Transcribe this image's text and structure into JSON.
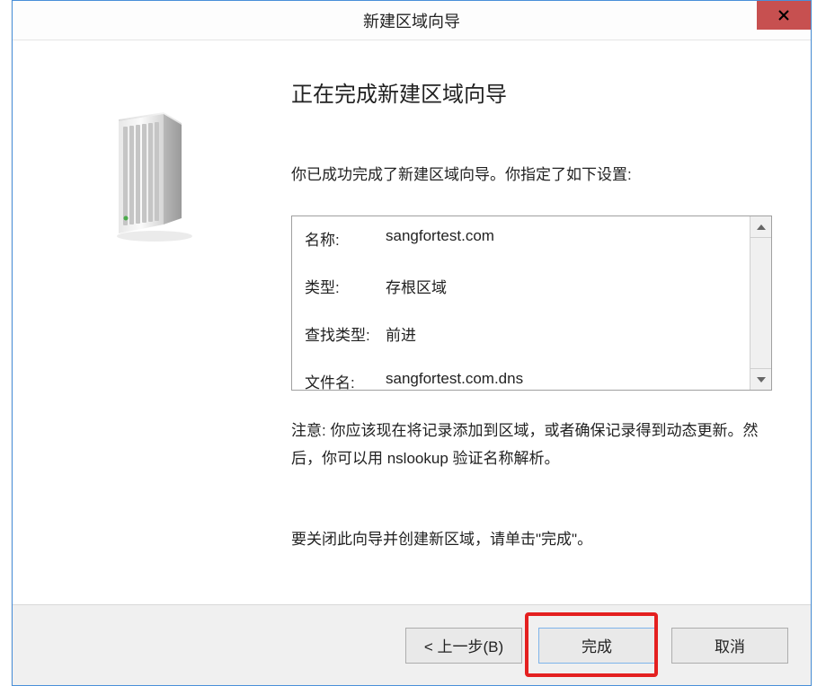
{
  "backdrop_text": "",
  "dialog": {
    "title": "新建区域向导",
    "close_label": "x",
    "heading": "正在完成新建区域向导",
    "description": "你已成功完成了新建区域向导。你指定了如下设置:",
    "settings": {
      "name_label": "名称:",
      "name_value": "sangfortest.com",
      "type_label": "类型:",
      "type_value": "存根区域",
      "lookup_label": "查找类型:",
      "lookup_value": "前进",
      "file_label": "文件名:",
      "file_value": "sangfortest.com.dns"
    },
    "note": "注意: 你应该现在将记录添加到区域，或者确保记录得到动态更新。然后，你可以用 nslookup 验证名称解析。",
    "close_instruction": "要关闭此向导并创建新区域，请单击\"完成\"。",
    "buttons": {
      "back": "< 上一步(B)",
      "finish": "完成",
      "cancel": "取消"
    }
  }
}
